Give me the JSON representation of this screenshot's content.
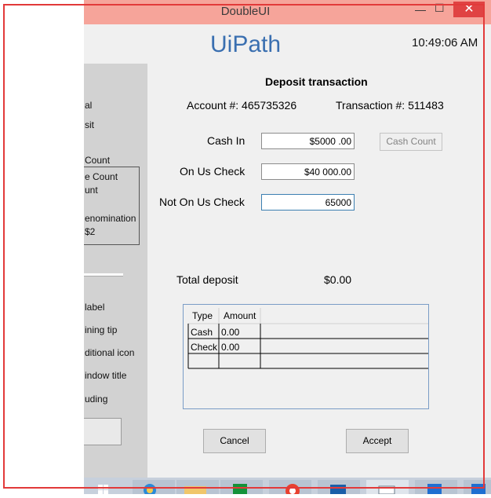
{
  "window": {
    "title": "DoubleUI",
    "minimize_glyph": "—",
    "maximize_glyph": "☐",
    "close_glyph": "✕"
  },
  "brand": "UiPath",
  "clock": "10:49:06 AM",
  "sidebar": {
    "items": [
      "al",
      "sit",
      "Count",
      "e Count",
      "unt",
      "enomination",
      "$2",
      "label",
      "ining tip",
      "ditional icon",
      "indow title",
      "uding"
    ]
  },
  "form": {
    "heading": "Deposit transaction",
    "account_label": "Account #: 465735326",
    "transaction_label": "Transaction #: 511483",
    "cash_in_label": "Cash In",
    "cash_in_value": "$5000 .00",
    "on_us_label": "On Us Check",
    "on_us_value": "$40 000.00",
    "not_on_us_label": "Not On Us Check",
    "not_on_us_value": "65000",
    "cash_count_button": "Cash Count",
    "total_label": "Total deposit",
    "total_value": "$0.00",
    "table": {
      "headers": [
        "Type",
        "Amount"
      ],
      "rows": [
        [
          "Cash",
          "0.00"
        ],
        [
          "Check",
          "0.00"
        ]
      ]
    },
    "cancel_button": "Cancel",
    "accept_button": "Accept"
  },
  "taskbar": {
    "icons": [
      "windows-start-icon",
      "ie-icon",
      "explorer-icon",
      "store-icon",
      "chrome-icon",
      "outlook-icon",
      "window-icon",
      "app-icon",
      "app-icon-2"
    ]
  }
}
